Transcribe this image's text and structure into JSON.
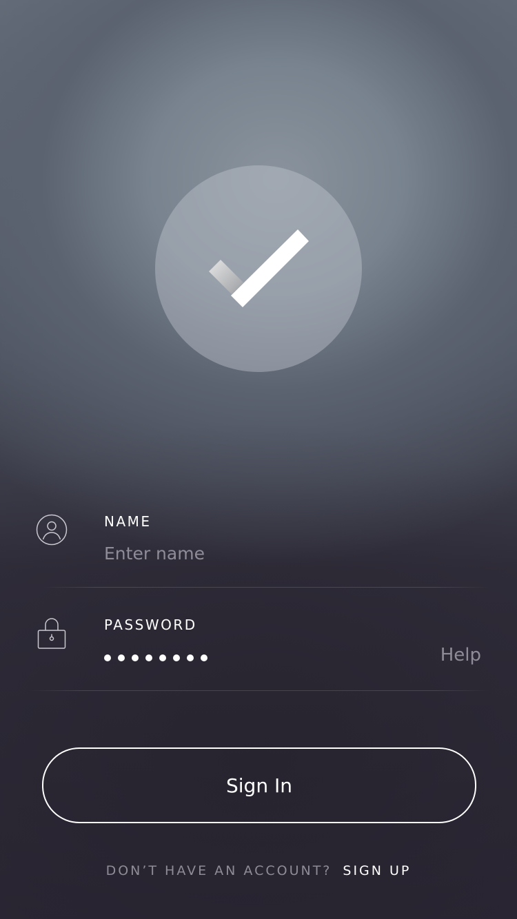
{
  "login": {
    "name_label": "NAME",
    "name_placeholder": "Enter name",
    "name_value": "",
    "password_label": "PASSWORD",
    "password_mask_count": 8,
    "help_label": "Help",
    "signin_label": "Sign In",
    "signup_prompt": "DON’T HAVE AN ACCOUNT?",
    "signup_label": "SIGN UP"
  },
  "icons": {
    "logo": "checkmark-icon",
    "name_field": "user-icon",
    "password_field": "lock-icon"
  },
  "colors": {
    "text_primary": "#ffffff",
    "text_muted": "#8f8c98",
    "background_dark": "#2a2633",
    "background_light": "#7a8590"
  }
}
